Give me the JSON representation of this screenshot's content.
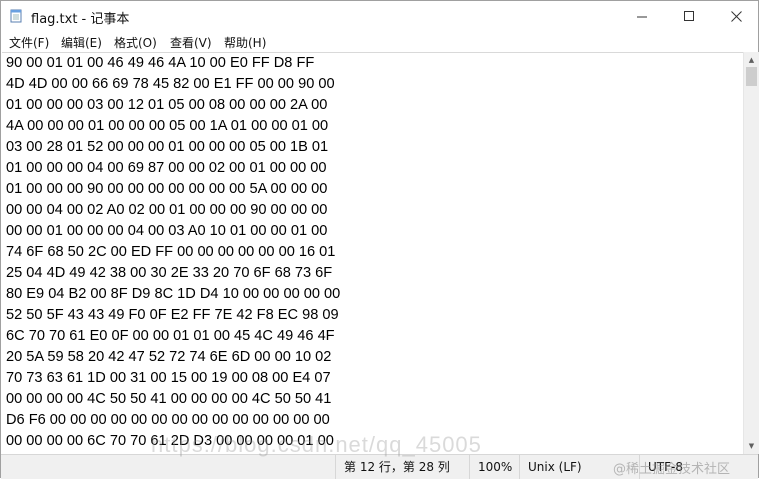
{
  "window": {
    "title": "flag.txt - 记事本",
    "controls": {
      "minimize": "—",
      "maximize": "☐",
      "close": "✕"
    }
  },
  "menu": [
    "文件(F)",
    "编辑(E)",
    "格式(O)",
    "查看(V)",
    "帮助(H)"
  ],
  "content": {
    "lines": [
      "90 00 01 01 00 46 49 46 4A 10 00 E0 FF D8 FF",
      "4D 4D 00 00 66 69 78 45 82 00 E1 FF 00 00 90 00",
      "01 00 00 00 03 00 12 01 05 00 08 00 00 00 2A 00",
      "4A 00 00 00 01 00 00 00 05 00 1A 01 00 00 01 00",
      "03 00 28 01 52 00 00 00 01 00 00 00 05 00 1B 01",
      "01 00 00 00 04 00 69 87 00 00 02 00 01 00 00 00",
      "01 00 00 00 90 00 00 00 00 00 00 00 5A 00 00 00",
      "00 00 04 00 02 A0 02 00 01 00 00 00 90 00 00 00",
      "00 00 01 00 00 00 04 00 03 A0 10 01 00 00 01 00",
      "74 6F 68 50 2C 00 ED FF 00 00 00 00 00 00 16 01",
      "25 04 4D 49 42 38 00 30 2E 33 20 70 6F 68 73 6F",
      "80 E9 04 B2 00 8F D9 8C 1D D4 10 00 00 00 00 00",
      "52 50 5F 43 43 49 F0 0F E2 FF 7E 42 F8 EC 98 09",
      "6C 70 70 61 E0 0F 00 00 01 01 00 45 4C 49 46 4F",
      "20 5A 59 58 20 42 47 52 72 74 6E 6D 00 00 10 02",
      "70 73 63 61 1D 00 31 00 15 00 19 00 08 00 E4 07",
      "00 00 00 00 4C 50 50 41 00 00 00 00 4C 50 50 41",
      "D6 F6 00 00 00 00 00 00 00 00 00 00 00 00 00 00",
      "00 00 00 00 6C 70 70 61 2D D3 00 00 00 00 01 00"
    ]
  },
  "status": {
    "position": "第 12 行，第 28 列",
    "zoom": "100%",
    "line_ending": "Unix (LF)",
    "encoding": "UTF-8"
  },
  "watermark": {
    "url": "https://blog.csdn.net/qq_45005",
    "community": "@稀土掘金技术社区"
  }
}
